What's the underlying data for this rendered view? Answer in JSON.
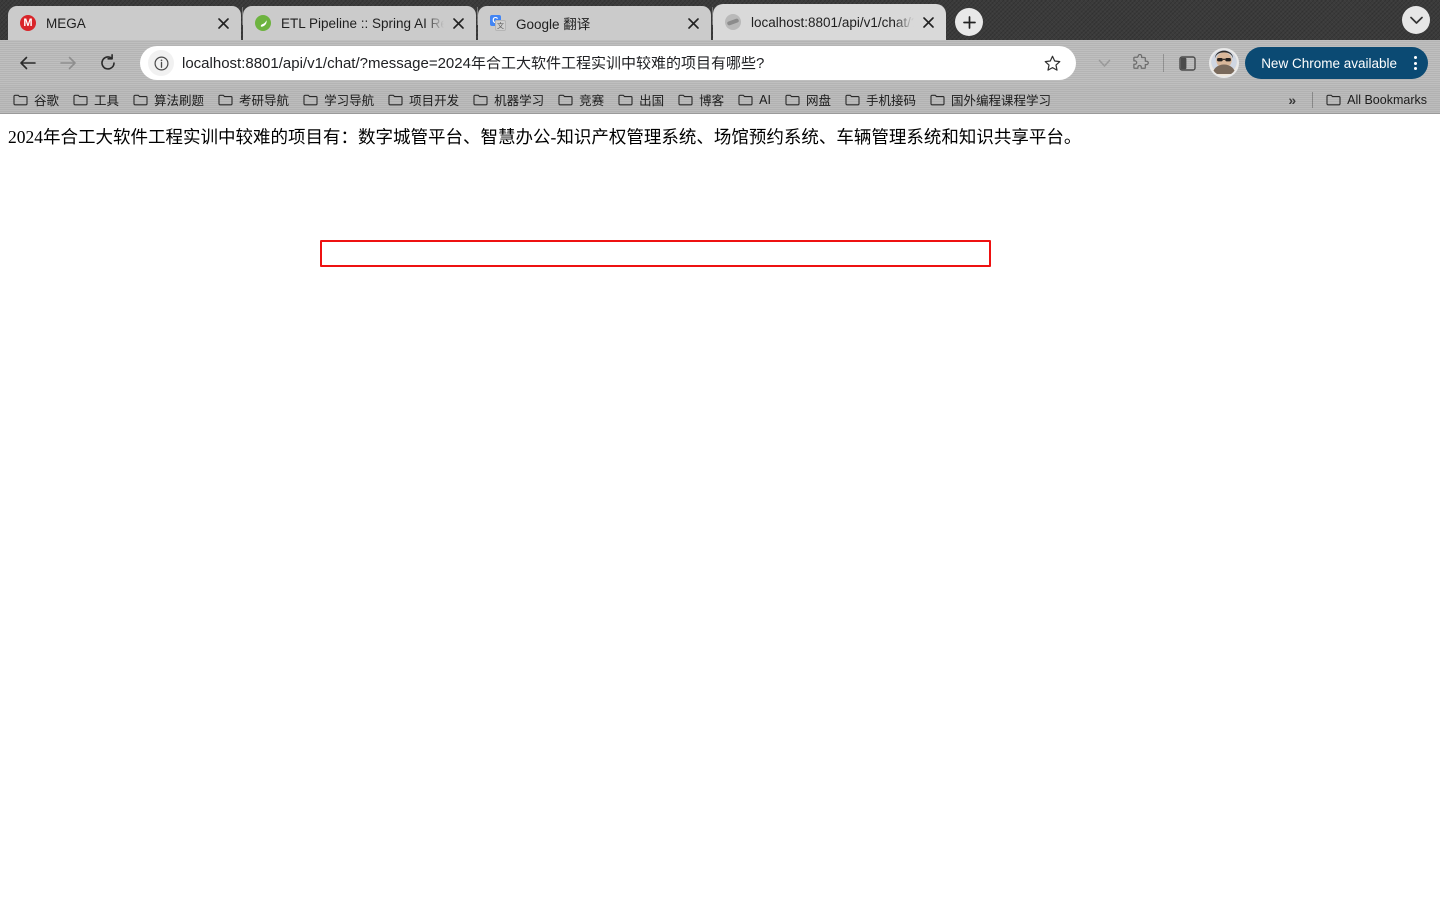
{
  "browser": {
    "tabs": [
      {
        "title": "MEGA",
        "favicon": "mega-icon",
        "active": false
      },
      {
        "title": "ETL Pipeline :: Spring AI Refer",
        "favicon": "spring-leaf-icon",
        "active": false
      },
      {
        "title": "Google 翻译",
        "favicon": "google-translate-icon",
        "active": false
      },
      {
        "title": "localhost:8801/api/v1/chat/?m",
        "favicon": "globe-icon",
        "active": true
      }
    ],
    "new_tab_label": "+",
    "tab_search_icon": "chevron-down-icon",
    "nav": {
      "back_icon": "arrow-left-icon",
      "forward_icon": "arrow-right-icon",
      "reload_icon": "reload-icon"
    },
    "omnibox": {
      "site_info_icon": "info-circle-icon",
      "url_prefix": "localhost:8801/api/v1/chat/?message=",
      "url_highlight": "2024年合工大软件工程实训中较难的项目有哪些?",
      "full_url": "localhost:8801/api/v1/chat/?message=2024年合工大软件工程实训中较难的项目有哪些?",
      "star_icon": "star-icon"
    },
    "toolbar_right": {
      "chevron_icon": "chevron-down-icon",
      "extensions_icon": "puzzle-piece-icon",
      "side_panel_icon": "side-panel-icon",
      "avatar_icon": "avatar",
      "update_button_label": "New Chrome available",
      "menu_icon": "kebab-menu-icon"
    },
    "bookmarks": {
      "items": [
        {
          "label": "谷歌"
        },
        {
          "label": "工具"
        },
        {
          "label": "算法刷题"
        },
        {
          "label": "考研导航"
        },
        {
          "label": "学习导航"
        },
        {
          "label": "项目开发"
        },
        {
          "label": "机器学习"
        },
        {
          "label": "竞赛"
        },
        {
          "label": "出国"
        },
        {
          "label": "博客"
        },
        {
          "label": "AI"
        },
        {
          "label": "网盘"
        },
        {
          "label": "手机接码"
        },
        {
          "label": "国外编程课程学习"
        }
      ],
      "overflow_label": "»",
      "all_bookmarks_label": "All Bookmarks"
    },
    "colors": {
      "tabstrip_bg": "#3b3b3b",
      "toolbar_bg": "#b8b8b8",
      "active_tab_bg": "#d9d9d9",
      "update_button_bg": "#0b4a73",
      "annotation_red": "#ee1111"
    }
  },
  "page": {
    "answer_prefix": "2024年合工大软件工程实训中较难的项目有：",
    "answer_highlight": "数字城管平台、智慧办公-知识产权管理系统、场馆预约系统、车辆管理系统和知识共享平台。",
    "full_text": "2024年合工大软件工程实训中较难的项目有：数字城管平台、智慧办公-知识产权管理系统、场馆预约系统、车辆管理系统和知识共享平台。"
  }
}
